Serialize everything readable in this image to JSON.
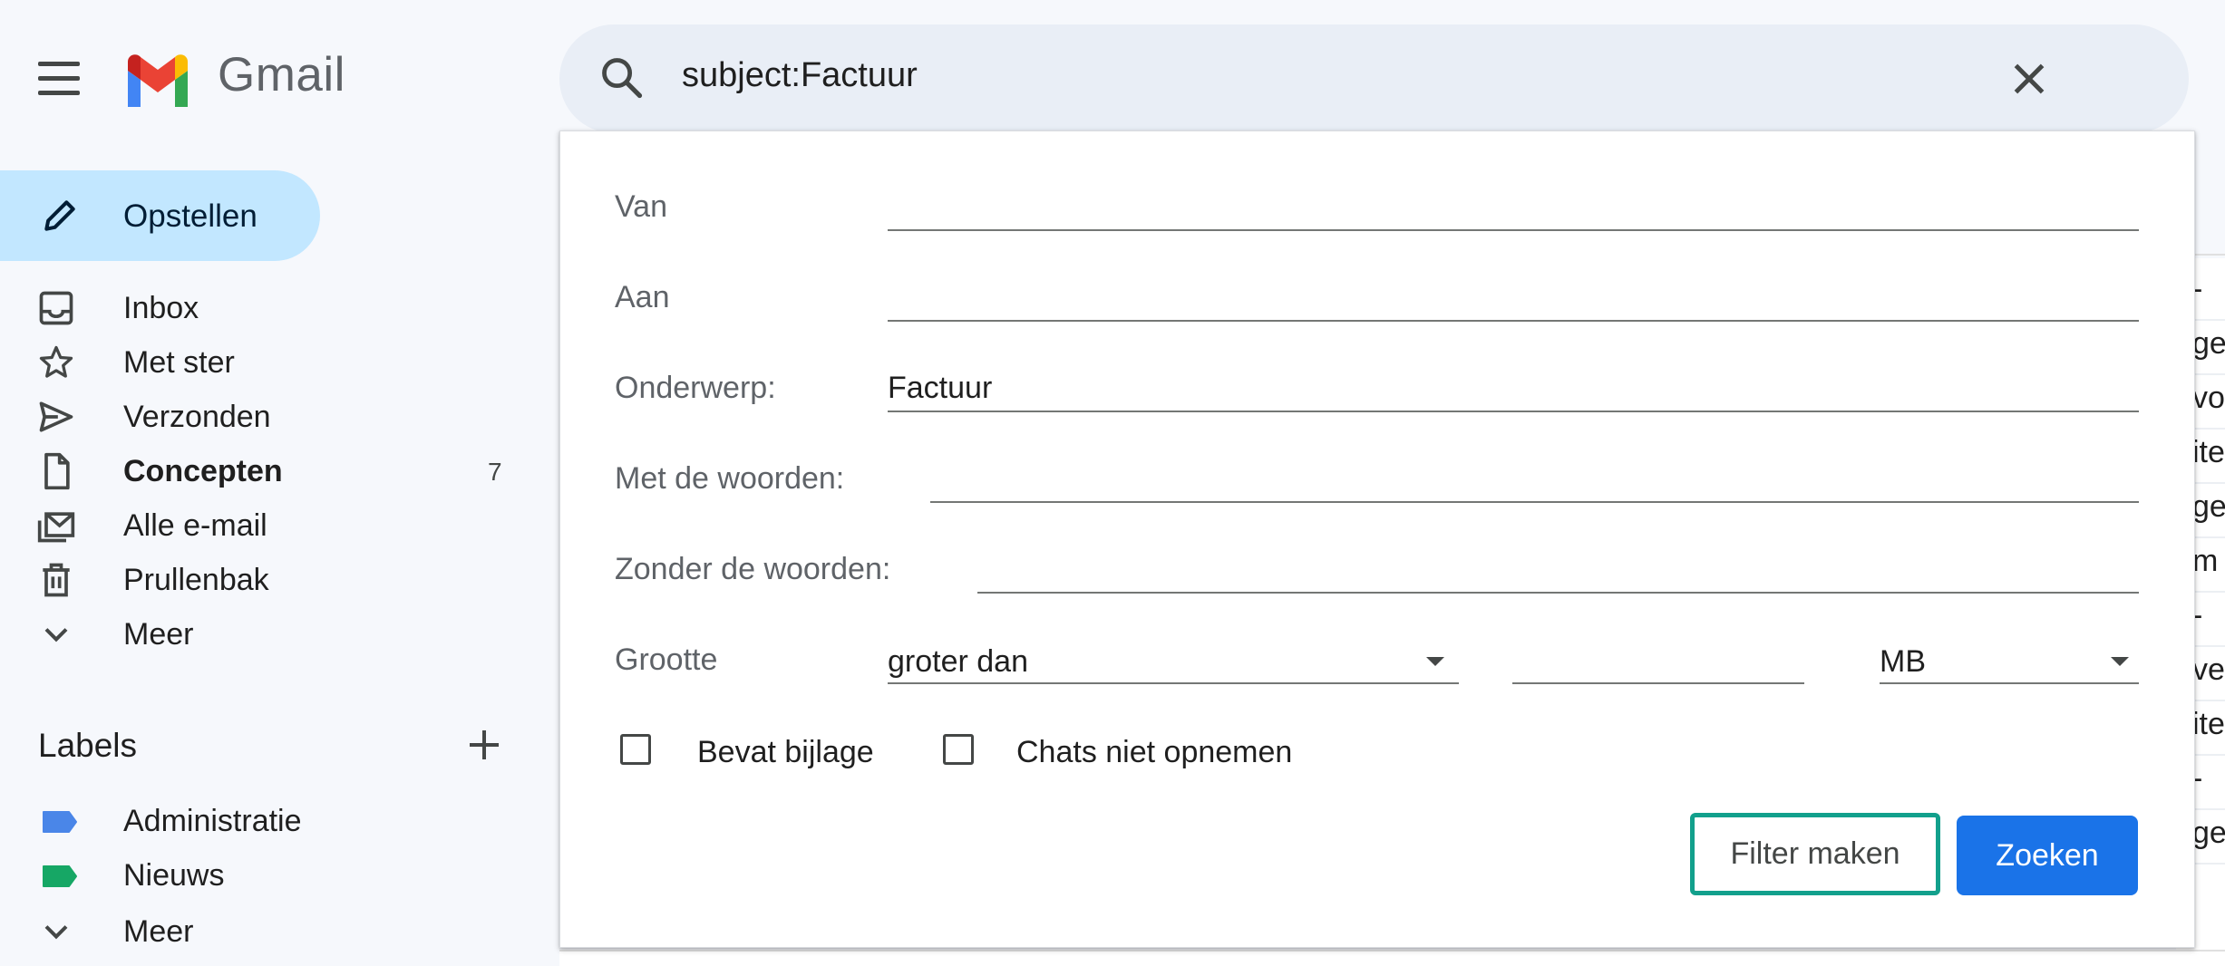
{
  "app": {
    "name": "Gmail"
  },
  "search": {
    "query": "subject:Factuur"
  },
  "sidebar": {
    "compose_label": "Opstellen",
    "items": [
      {
        "label": "Inbox",
        "icon": "inbox-icon"
      },
      {
        "label": "Met ster",
        "icon": "star-icon"
      },
      {
        "label": "Verzonden",
        "icon": "send-icon"
      },
      {
        "label": "Concepten",
        "icon": "draft-icon",
        "count": "7",
        "bold": true
      },
      {
        "label": "Alle e-mail",
        "icon": "all-mail-icon"
      },
      {
        "label": "Prullenbak",
        "icon": "trash-icon"
      },
      {
        "label": "Meer",
        "icon": "chevron-down-icon"
      }
    ],
    "labels_title": "Labels",
    "labels": [
      {
        "label": "Administratie",
        "color": "#4a86e8"
      },
      {
        "label": "Nieuws",
        "color": "#16a765"
      },
      {
        "label": "Meer",
        "icon": "chevron-down-icon"
      }
    ]
  },
  "search_options": {
    "from": {
      "label": "Van",
      "value": ""
    },
    "to": {
      "label": "Aan",
      "value": ""
    },
    "subject": {
      "label": "Onderwerp:",
      "value": "Factuur"
    },
    "has_words": {
      "label": "Met de woorden:",
      "value": ""
    },
    "doesnt_have": {
      "label": "Zonder de woorden:",
      "value": ""
    },
    "size": {
      "label": "Grootte",
      "operator": "groter dan",
      "value": "",
      "unit": "MB"
    },
    "has_attachment": {
      "label": "Bevat bijlage",
      "checked": false
    },
    "exclude_chats": {
      "label": "Chats niet opnemen",
      "checked": false
    },
    "create_filter_label": "Filter maken",
    "search_label": "Zoeken"
  },
  "background_list_fragments": [
    "- ",
    "gev",
    "vo",
    "ite",
    "gev",
    "m u",
    "- ",
    "ve",
    "ite",
    "- ",
    "gev"
  ],
  "colors": {
    "accent": "#1a73e8",
    "compose_bg": "#c2e7ff",
    "focus_ring": "#12a08c"
  }
}
